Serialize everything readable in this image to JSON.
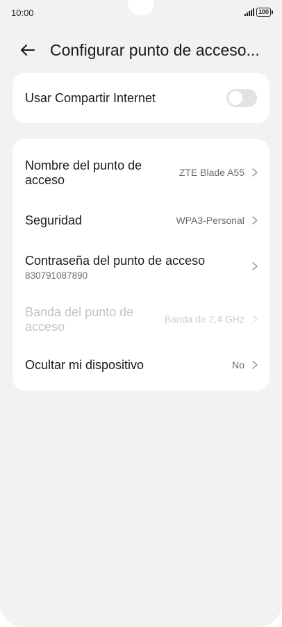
{
  "status_bar": {
    "time": "10:00",
    "battery": "100",
    "icons": [
      "signal-icon",
      "battery-icon"
    ]
  },
  "header": {
    "title": "Configurar punto de acceso...",
    "back_icon": "back-arrow-icon"
  },
  "hotspot_toggle": {
    "label": "Usar Compartir Internet",
    "enabled": false
  },
  "settings": {
    "ap_name": {
      "label_line1": "Nombre del punto de",
      "label_line2": "acceso",
      "value": "ZTE Blade A55"
    },
    "security": {
      "label": "Seguridad",
      "value": "WPA3-Personal"
    },
    "password": {
      "label": "Contraseña del punto de acceso",
      "value": "830791087890"
    },
    "band": {
      "label_line1": "Banda del punto de",
      "label_line2": "acceso",
      "value": "Banda de 2,4 GHz",
      "disabled": true
    },
    "hide_device": {
      "label": "Ocultar mi dispositivo",
      "value": "No"
    }
  },
  "colors": {
    "background": "#f2f2f2",
    "card": "#ffffff",
    "toggle_off": "#e2e2e2",
    "secondary_text": "#6a6a6a",
    "disabled_text": "#c4c4c4"
  }
}
